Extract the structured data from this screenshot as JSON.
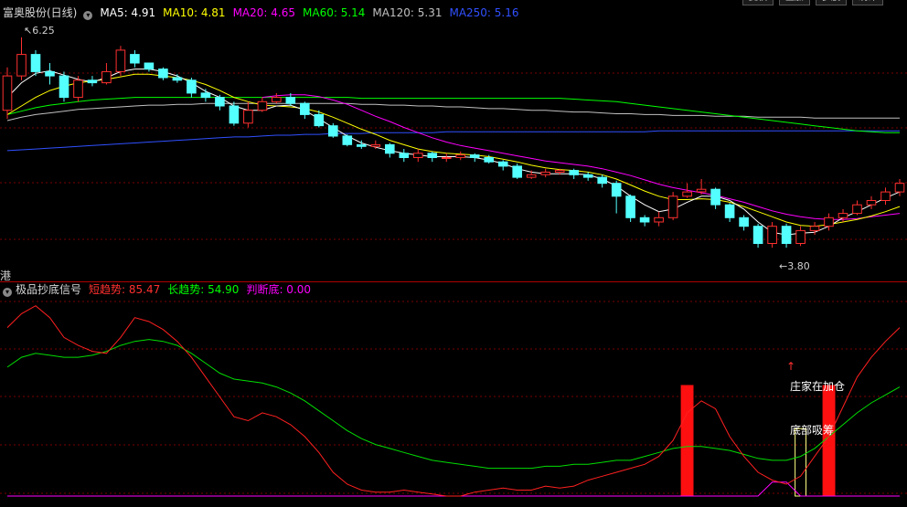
{
  "top_buttons": [
    "复权",
    "叠加",
    "多股",
    "统计"
  ],
  "stock": {
    "title": "富奥股份(日线)"
  },
  "ma_legend": [
    {
      "label": "MA5: 4.91",
      "color": "#ffffff"
    },
    {
      "label": "MA10: 4.81",
      "color": "#ffff00"
    },
    {
      "label": "MA20: 4.65",
      "color": "#ff00ff"
    },
    {
      "label": "MA60: 5.14",
      "color": "#00ff00"
    },
    {
      "label": "MA120: 5.31",
      "color": "#c0c0c0"
    },
    {
      "label": "MA250: 5.16",
      "color": "#3050ff"
    }
  ],
  "price_markers": {
    "high": "6.25",
    "low": "3.80"
  },
  "hk_label": "港",
  "indicator": {
    "title": "极品抄底信号",
    "legend": [
      {
        "label": "短趋势: 85.47",
        "color": "#ff3030"
      },
      {
        "label": "长趋势: 54.90",
        "color": "#00ff00"
      },
      {
        "label": "判断底: 0.00",
        "color": "#ff00ff"
      }
    ],
    "annotations": {
      "add": "庄家在加仓",
      "bottom": "底部吸筹"
    }
  },
  "colors": {
    "up": "#ff3030",
    "down": "#54ffff",
    "grid": "#7a0000"
  },
  "chart_data": {
    "type": "candlestick",
    "y_range": [
      3.6,
      6.45
    ],
    "candles": [
      [
        5.4,
        5.8,
        5.9,
        5.3
      ],
      [
        5.8,
        6.05,
        6.25,
        5.75
      ],
      [
        6.05,
        5.85,
        6.1,
        5.8
      ],
      [
        5.85,
        5.8,
        5.95,
        5.7
      ],
      [
        5.8,
        5.55,
        5.85,
        5.5
      ],
      [
        5.55,
        5.75,
        5.8,
        5.5
      ],
      [
        5.75,
        5.72,
        5.8,
        5.68
      ],
      [
        5.72,
        5.85,
        5.95,
        5.7
      ],
      [
        5.85,
        6.1,
        6.15,
        5.8
      ],
      [
        6.05,
        5.95,
        6.1,
        5.9
      ],
      [
        5.95,
        5.88,
        5.95,
        5.85
      ],
      [
        5.88,
        5.78,
        5.9,
        5.75
      ],
      [
        5.78,
        5.75,
        5.82,
        5.72
      ],
      [
        5.75,
        5.6,
        5.78,
        5.55
      ],
      [
        5.6,
        5.55,
        5.65,
        5.5
      ],
      [
        5.55,
        5.45,
        5.58,
        5.4
      ],
      [
        5.45,
        5.25,
        5.5,
        5.22
      ],
      [
        5.25,
        5.4,
        5.5,
        5.2
      ],
      [
        5.4,
        5.5,
        5.55,
        5.38
      ],
      [
        5.5,
        5.55,
        5.6,
        5.48
      ],
      [
        5.55,
        5.48,
        5.6,
        5.45
      ],
      [
        5.48,
        5.35,
        5.5,
        5.3
      ],
      [
        5.35,
        5.22,
        5.4,
        5.2
      ],
      [
        5.22,
        5.1,
        5.25,
        5.08
      ],
      [
        5.1,
        5.0,
        5.12,
        4.98
      ],
      [
        5.0,
        4.98,
        5.05,
        4.95
      ],
      [
        4.98,
        5.0,
        5.05,
        4.95
      ],
      [
        5.0,
        4.9,
        5.02,
        4.85
      ],
      [
        4.9,
        4.85,
        4.95,
        4.8
      ],
      [
        4.85,
        4.9,
        4.95,
        4.8
      ],
      [
        4.9,
        4.85,
        4.92,
        4.8
      ],
      [
        4.85,
        4.85,
        4.9,
        4.8
      ],
      [
        4.85,
        4.88,
        4.92,
        4.82
      ],
      [
        4.88,
        4.85,
        4.9,
        4.8
      ],
      [
        4.85,
        4.8,
        4.88,
        4.78
      ],
      [
        4.8,
        4.75,
        4.82,
        4.7
      ],
      [
        4.75,
        4.62,
        4.78,
        4.6
      ],
      [
        4.62,
        4.65,
        4.7,
        4.6
      ],
      [
        4.65,
        4.68,
        4.72,
        4.62
      ],
      [
        4.68,
        4.7,
        4.72,
        4.65
      ],
      [
        4.7,
        4.65,
        4.72,
        4.6
      ],
      [
        4.65,
        4.62,
        4.68,
        4.58
      ],
      [
        4.62,
        4.55,
        4.65,
        4.5
      ],
      [
        4.55,
        4.4,
        4.58,
        4.2
      ],
      [
        4.4,
        4.15,
        4.42,
        4.1
      ],
      [
        4.15,
        4.1,
        4.18,
        4.05
      ],
      [
        4.1,
        4.15,
        4.22,
        4.05
      ],
      [
        4.15,
        4.4,
        4.45,
        4.12
      ],
      [
        4.4,
        4.45,
        4.55,
        4.38
      ],
      [
        4.45,
        4.48,
        4.6,
        4.42
      ],
      [
        4.48,
        4.3,
        4.5,
        4.25
      ],
      [
        4.3,
        4.15,
        4.32,
        4.1
      ],
      [
        4.15,
        4.05,
        4.18,
        4.0
      ],
      [
        4.05,
        3.85,
        4.08,
        3.8
      ],
      [
        3.85,
        4.05,
        4.1,
        3.8
      ],
      [
        4.05,
        3.85,
        4.08,
        3.8
      ],
      [
        3.85,
        4.0,
        4.05,
        3.82
      ],
      [
        4.0,
        4.05,
        4.1,
        3.95
      ],
      [
        4.05,
        4.15,
        4.2,
        4.0
      ],
      [
        4.15,
        4.2,
        4.25,
        4.1
      ],
      [
        4.2,
        4.3,
        4.35,
        4.18
      ],
      [
        4.3,
        4.35,
        4.4,
        4.25
      ],
      [
        4.35,
        4.45,
        4.5,
        4.3
      ],
      [
        4.45,
        4.55,
        4.6,
        4.4
      ]
    ],
    "ma5": [
      5.55,
      5.72,
      5.83,
      5.86,
      5.81,
      5.76,
      5.73,
      5.78,
      5.85,
      5.88,
      5.88,
      5.85,
      5.8,
      5.72,
      5.62,
      5.55,
      5.45,
      5.4,
      5.4,
      5.45,
      5.46,
      5.4,
      5.3,
      5.2,
      5.1,
      5.02,
      4.97,
      4.93,
      4.9,
      4.88,
      4.86,
      4.86,
      4.86,
      4.85,
      4.82,
      4.78,
      4.72,
      4.68,
      4.66,
      4.66,
      4.66,
      4.65,
      4.6,
      4.52,
      4.4,
      4.3,
      4.22,
      4.25,
      4.33,
      4.4,
      4.4,
      4.35,
      4.25,
      4.1,
      3.98,
      3.95,
      3.97,
      3.98,
      4.05,
      4.15,
      4.22,
      4.3,
      4.38,
      4.45
    ],
    "ma10": [
      5.35,
      5.45,
      5.55,
      5.63,
      5.68,
      5.72,
      5.74,
      5.76,
      5.79,
      5.82,
      5.82,
      5.8,
      5.78,
      5.75,
      5.7,
      5.63,
      5.55,
      5.5,
      5.46,
      5.45,
      5.44,
      5.42,
      5.38,
      5.32,
      5.25,
      5.18,
      5.12,
      5.05,
      5.0,
      4.95,
      4.92,
      4.9,
      4.89,
      4.88,
      4.86,
      4.83,
      4.8,
      4.76,
      4.73,
      4.71,
      4.7,
      4.68,
      4.65,
      4.6,
      4.53,
      4.46,
      4.4,
      4.36,
      4.36,
      4.37,
      4.36,
      4.33,
      4.28,
      4.22,
      4.16,
      4.1,
      4.06,
      4.05,
      4.07,
      4.1,
      4.13,
      4.17,
      4.22,
      4.28
    ],
    "ma20": [
      null,
      null,
      null,
      null,
      null,
      null,
      null,
      null,
      null,
      null,
      null,
      null,
      null,
      null,
      null,
      null,
      null,
      null,
      5.55,
      5.57,
      5.58,
      5.58,
      5.56,
      5.52,
      5.47,
      5.4,
      5.33,
      5.27,
      5.2,
      5.14,
      5.08,
      5.03,
      4.99,
      4.96,
      4.93,
      4.9,
      4.87,
      4.84,
      4.81,
      4.79,
      4.77,
      4.75,
      4.72,
      4.68,
      4.64,
      4.59,
      4.54,
      4.5,
      4.47,
      4.44,
      4.41,
      4.37,
      4.33,
      4.28,
      4.23,
      4.19,
      4.16,
      4.14,
      4.13,
      4.13,
      4.14,
      4.16,
      4.18,
      4.2
    ],
    "ma60": [
      5.35,
      5.39,
      5.43,
      5.46,
      5.48,
      5.5,
      5.52,
      5.53,
      5.54,
      5.55,
      5.55,
      5.55,
      5.55,
      5.55,
      5.55,
      5.55,
      5.55,
      5.55,
      5.55,
      5.55,
      5.55,
      5.55,
      5.55,
      5.55,
      5.55,
      5.54,
      5.54,
      5.54,
      5.54,
      5.54,
      5.54,
      5.54,
      5.54,
      5.54,
      5.54,
      5.54,
      5.54,
      5.54,
      5.54,
      5.54,
      5.53,
      5.52,
      5.51,
      5.5,
      5.48,
      5.46,
      5.44,
      5.42,
      5.4,
      5.38,
      5.36,
      5.34,
      5.32,
      5.3,
      5.28,
      5.26,
      5.24,
      5.22,
      5.2,
      5.18,
      5.16,
      5.15,
      5.14,
      5.14
    ],
    "ma120": [
      5.28,
      5.32,
      5.35,
      5.37,
      5.39,
      5.41,
      5.42,
      5.43,
      5.44,
      5.45,
      5.46,
      5.46,
      5.47,
      5.47,
      5.48,
      5.48,
      5.48,
      5.48,
      5.48,
      5.48,
      5.48,
      5.48,
      5.48,
      5.48,
      5.48,
      5.47,
      5.47,
      5.46,
      5.46,
      5.45,
      5.45,
      5.44,
      5.44,
      5.43,
      5.42,
      5.42,
      5.41,
      5.4,
      5.4,
      5.39,
      5.38,
      5.38,
      5.37,
      5.36,
      5.36,
      5.35,
      5.35,
      5.34,
      5.34,
      5.34,
      5.33,
      5.33,
      5.33,
      5.32,
      5.32,
      5.32,
      5.32,
      5.31,
      5.31,
      5.31,
      5.31,
      5.31,
      5.31,
      5.31
    ],
    "ma250": [
      4.93,
      4.94,
      4.95,
      4.96,
      4.97,
      4.98,
      4.99,
      5.0,
      5.01,
      5.02,
      5.03,
      5.04,
      5.05,
      5.06,
      5.07,
      5.08,
      5.09,
      5.09,
      5.1,
      5.11,
      5.11,
      5.12,
      5.12,
      5.13,
      5.13,
      5.13,
      5.14,
      5.14,
      5.14,
      5.14,
      5.14,
      5.15,
      5.15,
      5.15,
      5.15,
      5.15,
      5.15,
      5.15,
      5.15,
      5.15,
      5.15,
      5.15,
      5.15,
      5.15,
      5.15,
      5.15,
      5.16,
      5.16,
      5.16,
      5.16,
      5.16,
      5.16,
      5.16,
      5.16,
      5.16,
      5.16,
      5.16,
      5.16,
      5.16,
      5.16,
      5.16,
      5.16,
      5.16,
      5.16
    ],
    "indicator": {
      "y_range": [
        0,
        100
      ],
      "short_trend": [
        85,
        92,
        96,
        90,
        80,
        76,
        73,
        72,
        80,
        90,
        88,
        84,
        78,
        70,
        60,
        50,
        40,
        38,
        42,
        40,
        36,
        30,
        22,
        12,
        6,
        3,
        2,
        2,
        3,
        2,
        1,
        0,
        0,
        2,
        3,
        4,
        3,
        3,
        5,
        4,
        5,
        8,
        10,
        12,
        14,
        16,
        20,
        28,
        42,
        48,
        44,
        30,
        20,
        12,
        8,
        6,
        10,
        20,
        30,
        45,
        60,
        70,
        78,
        85
      ],
      "long_trend": [
        65,
        70,
        72,
        71,
        70,
        70,
        71,
        73,
        76,
        78,
        79,
        78,
        76,
        72,
        67,
        62,
        59,
        58,
        57,
        55,
        52,
        48,
        43,
        38,
        33,
        29,
        26,
        24,
        22,
        20,
        18,
        17,
        16,
        15,
        14,
        14,
        14,
        14,
        15,
        15,
        16,
        16,
        17,
        18,
        18,
        20,
        22,
        24,
        25,
        25,
        24,
        23,
        21,
        19,
        18,
        18,
        20,
        24,
        30,
        36,
        42,
        47,
        51,
        55
      ],
      "signal": [
        0,
        0,
        0,
        0,
        0,
        0,
        0,
        0,
        0,
        0,
        0,
        0,
        0,
        0,
        0,
        0,
        0,
        0,
        0,
        0,
        0,
        0,
        0,
        0,
        0,
        0,
        0,
        0,
        0,
        0,
        0,
        0,
        0,
        0,
        0,
        0,
        0,
        0,
        0,
        0,
        0,
        0,
        0,
        0,
        0,
        0,
        0,
        0,
        0,
        0,
        0,
        0,
        0,
        0,
        7,
        7,
        0,
        0,
        0,
        0,
        0,
        0,
        0,
        0
      ],
      "red_bars": [
        {
          "i": 48,
          "v": 56
        },
        {
          "i": 58,
          "v": 56
        }
      ],
      "yellow_bar": {
        "i": 56,
        "v": 34
      }
    }
  }
}
